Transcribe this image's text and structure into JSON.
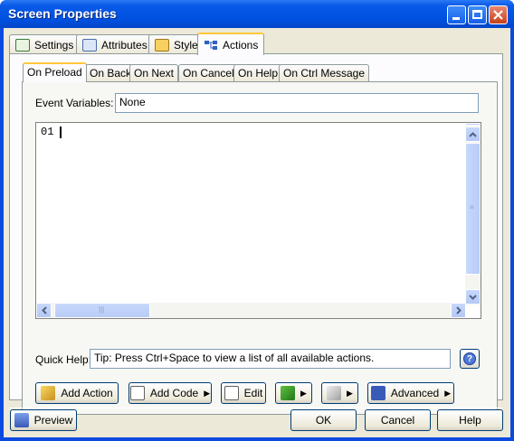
{
  "window": {
    "title": "Screen Properties"
  },
  "tabs": [
    {
      "label": "Settings",
      "icon": "settings-icon"
    },
    {
      "label": "Attributes",
      "icon": "attributes-icon"
    },
    {
      "label": "Style",
      "icon": "style-icon"
    },
    {
      "label": "Actions",
      "icon": "actions-icon"
    }
  ],
  "subtabs": [
    {
      "label": "On Preload"
    },
    {
      "label": "On Back"
    },
    {
      "label": "On Next"
    },
    {
      "label": "On Cancel"
    },
    {
      "label": "On Help"
    },
    {
      "label": "On Ctrl Message"
    }
  ],
  "event_variables": {
    "label": "Event Variables:",
    "value": "None"
  },
  "editor": {
    "line_number": "01",
    "content": ""
  },
  "quick_help": {
    "label": "Quick Help:",
    "value": "Tip: Press Ctrl+Space to view a list of all available actions."
  },
  "action_buttons": {
    "add_action": "Add Action",
    "add_code": "Add Code",
    "edit": "Edit",
    "advanced": "Advanced"
  },
  "footer": {
    "preview": "Preview",
    "ok": "OK",
    "cancel": "Cancel",
    "help": "Help"
  }
}
